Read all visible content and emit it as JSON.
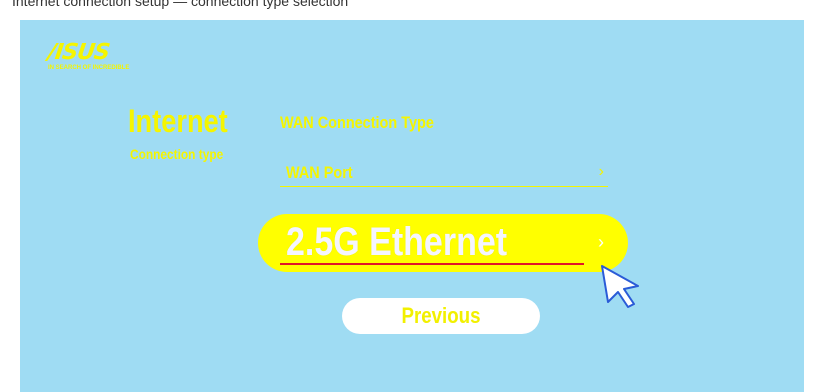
{
  "caption": "Internet connection setup — connection type selection",
  "logo": {
    "word": "/ISUS",
    "tagline": "IN SEARCH OF INCREDIBLE"
  },
  "section": {
    "title": "Internet",
    "subtitle": "Connection type"
  },
  "wan": {
    "type_label": "WAN Connection Type",
    "port_label": "WAN Port",
    "chevron": "›"
  },
  "options": {
    "selected_label": "2.5G Ethernet",
    "chevron": "›"
  },
  "previous_label": "Previous",
  "colors": {
    "panel_bg": "#9fdcf3",
    "accent_yellow": "#f5f500",
    "button_yellow": "#ffff00",
    "underline_red": "#e0152a"
  }
}
